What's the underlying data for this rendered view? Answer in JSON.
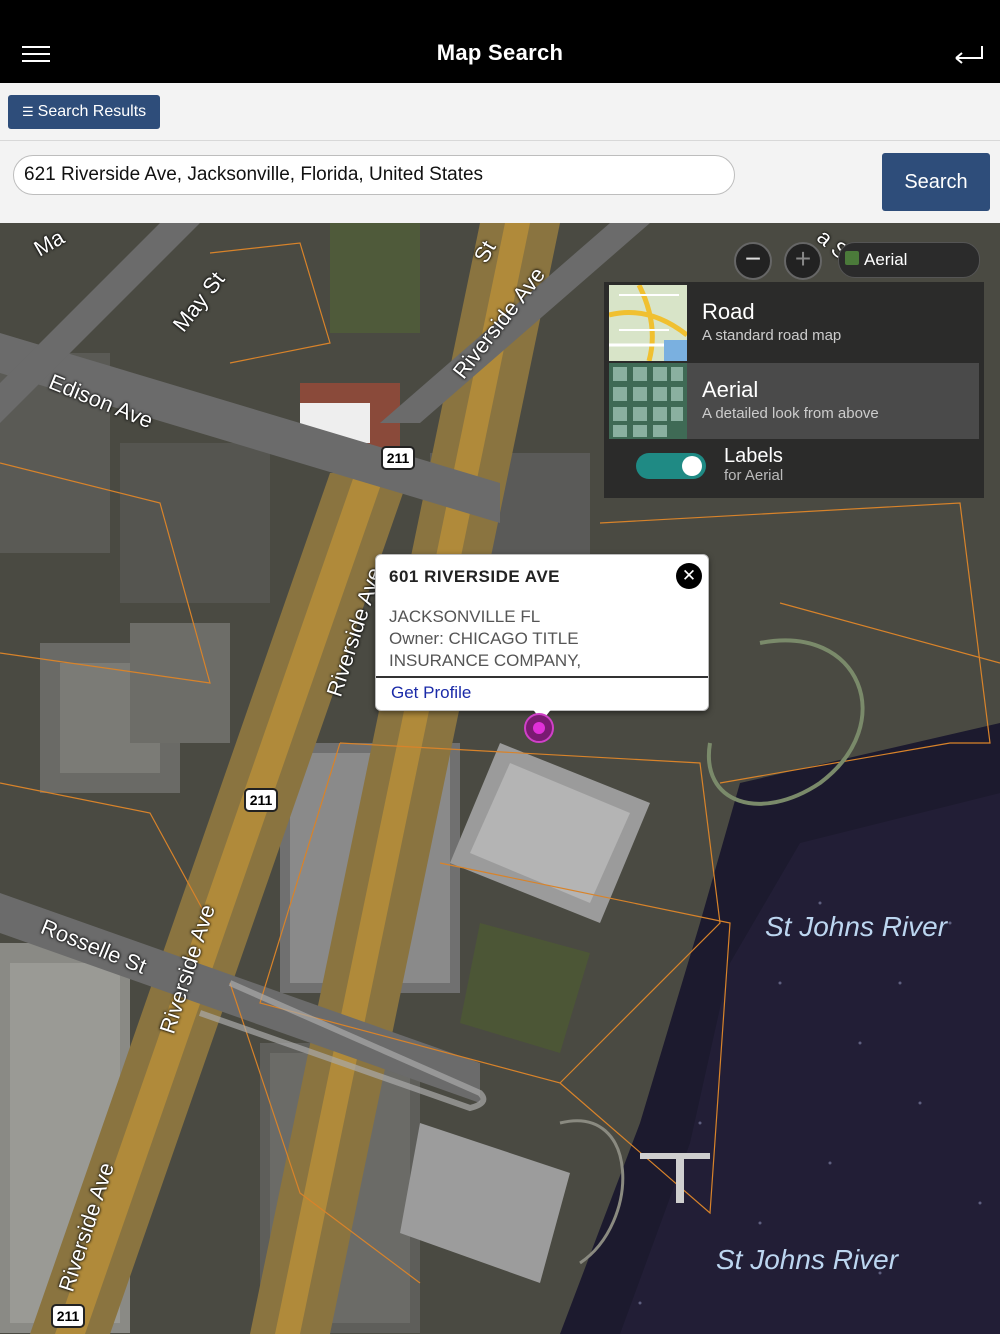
{
  "header": {
    "title": "Map Search",
    "menu_icon": "hamburger-menu-icon",
    "back_icon": "return-arrow-icon"
  },
  "toolbar": {
    "results_label": "Search Results",
    "results_icon": "list-icon"
  },
  "search": {
    "value": "621 Riverside Ave, Jacksonville, Florida, United States",
    "button_label": "Search"
  },
  "map": {
    "zoom_out": "−",
    "zoom_in": "+",
    "style_selected": "Aerial",
    "streets": [
      "May St",
      "Edison Ave",
      "Riverside Ave",
      "Riverside Ave",
      "Riverside Ave",
      "Riverside Ave",
      "Rosselle St",
      "Ma",
      "St",
      "a S"
    ],
    "shields": [
      "211",
      "211",
      "211"
    ],
    "rivers": [
      "St Johns River",
      "St Johns River"
    ],
    "style_panel": {
      "options": [
        {
          "title": "Road",
          "desc": "A standard road map"
        },
        {
          "title": "Aerial",
          "desc": "A detailed look from above"
        }
      ],
      "labels_title": "Labels",
      "labels_sub": "for Aerial",
      "labels_on": true
    }
  },
  "popup": {
    "title": "601 RIVERSIDE AVE",
    "line1": "JACKSONVILLE FL",
    "line2": "Owner: CHICAGO TITLE",
    "line3": "INSURANCE COMPANY,",
    "link": "Get Profile",
    "close": "✕"
  }
}
